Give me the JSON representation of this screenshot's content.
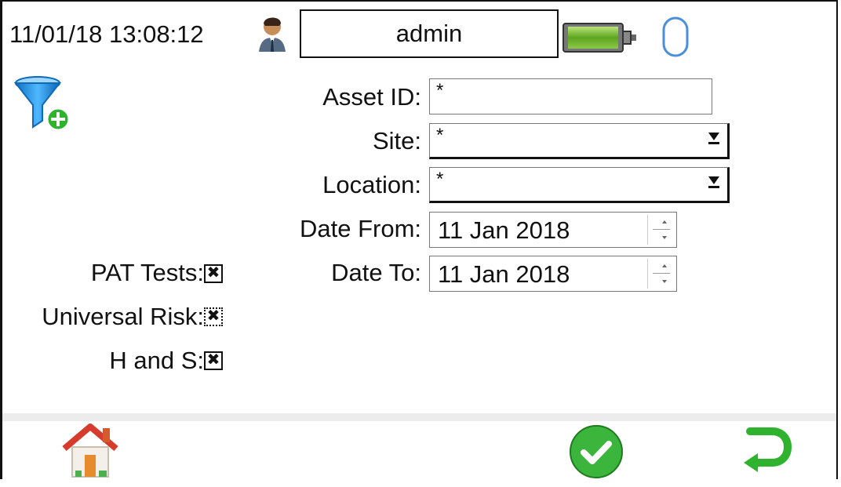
{
  "status_bar": {
    "datetime": "11/01/18 13:08:12",
    "username": "admin",
    "user_icon": "user-avatar-icon",
    "battery_icon": "battery-icon",
    "connection_icon": "mouse-icon"
  },
  "filter": {
    "icon": "add-filter-icon",
    "asset_id": {
      "label": "Asset ID:",
      "value": "*"
    },
    "site": {
      "label": "Site:",
      "value": "*"
    },
    "location": {
      "label": "Location:",
      "value": "*"
    },
    "date_from": {
      "label": "Date From:",
      "value": "11 Jan 2018"
    },
    "date_to": {
      "label": "Date To:",
      "value": "11 Jan 2018"
    }
  },
  "test_types": [
    {
      "label": "PAT Tests:",
      "checked": true
    },
    {
      "label": "Universal Risk:",
      "checked": true
    },
    {
      "label": "H and S:",
      "checked": true
    }
  ],
  "footer": {
    "home_icon": "home-icon",
    "ok_icon": "checkmark-icon",
    "back_icon": "return-arrow-icon"
  },
  "colors": {
    "accent_green": "#2fb32f",
    "filter_blue": "#1e8ed6",
    "bar_gray": "#ececec"
  }
}
